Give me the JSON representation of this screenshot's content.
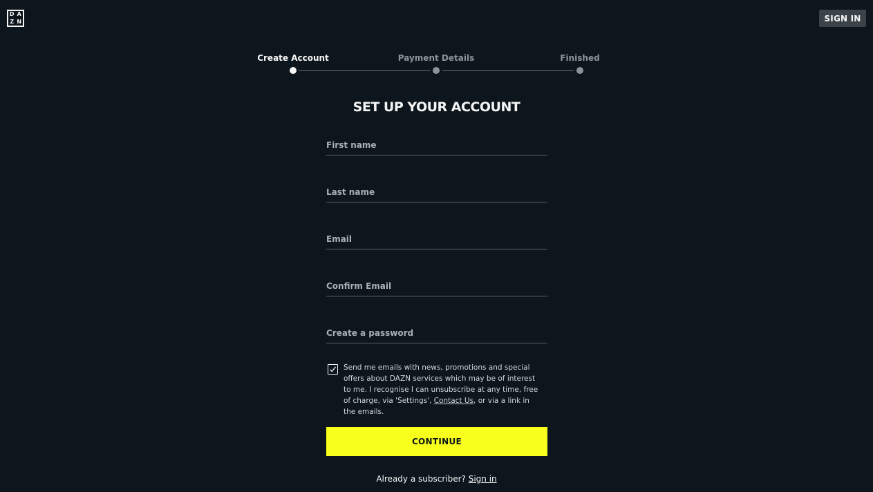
{
  "header": {
    "logo_letters": [
      "D",
      "A",
      "Z",
      "N"
    ],
    "sign_in_label": "SIGN IN"
  },
  "stepper": {
    "steps": [
      {
        "label": "Create Account",
        "state": "active"
      },
      {
        "label": "Payment Details",
        "state": "inactive"
      },
      {
        "label": "Finished",
        "state": "inactive"
      }
    ]
  },
  "form": {
    "title": "SET UP YOUR ACCOUNT",
    "fields": [
      {
        "placeholder": "First name",
        "value": ""
      },
      {
        "placeholder": "Last name",
        "value": ""
      },
      {
        "placeholder": "Email",
        "value": ""
      },
      {
        "placeholder": "Confirm Email",
        "value": ""
      },
      {
        "placeholder": "Create a password",
        "value": ""
      }
    ],
    "consent": {
      "checked": true,
      "text_before_link": "Send me emails with news, promotions and special offers about DAZN services which may be of interest to me. I recognise I can unsubscribe at any time, free of charge, via 'Settings', ",
      "link_text": "Contact Us",
      "text_after_link": ", or via a link in the emails."
    },
    "continue_label": "CONTINUE",
    "already_text": "Already a subscriber? ",
    "sign_in_link": "Sign in"
  },
  "colors": {
    "background": "#0c161c",
    "accent": "#f7ff1a",
    "button_secondary": "#3b4248"
  }
}
